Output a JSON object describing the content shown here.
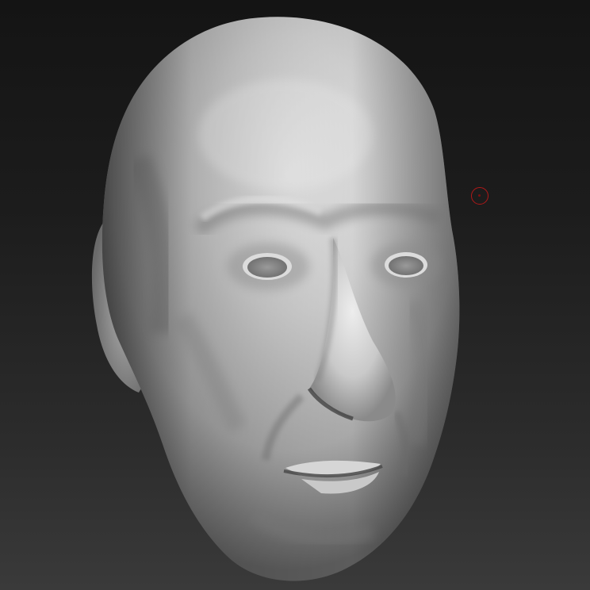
{
  "viewport": {
    "background_top": "#141414",
    "background_bottom": "#3a3a3a"
  },
  "model": {
    "subject": "sculpted-head",
    "material_color": "#bdbdbd"
  },
  "brush_cursor": {
    "color": "#b01818"
  }
}
